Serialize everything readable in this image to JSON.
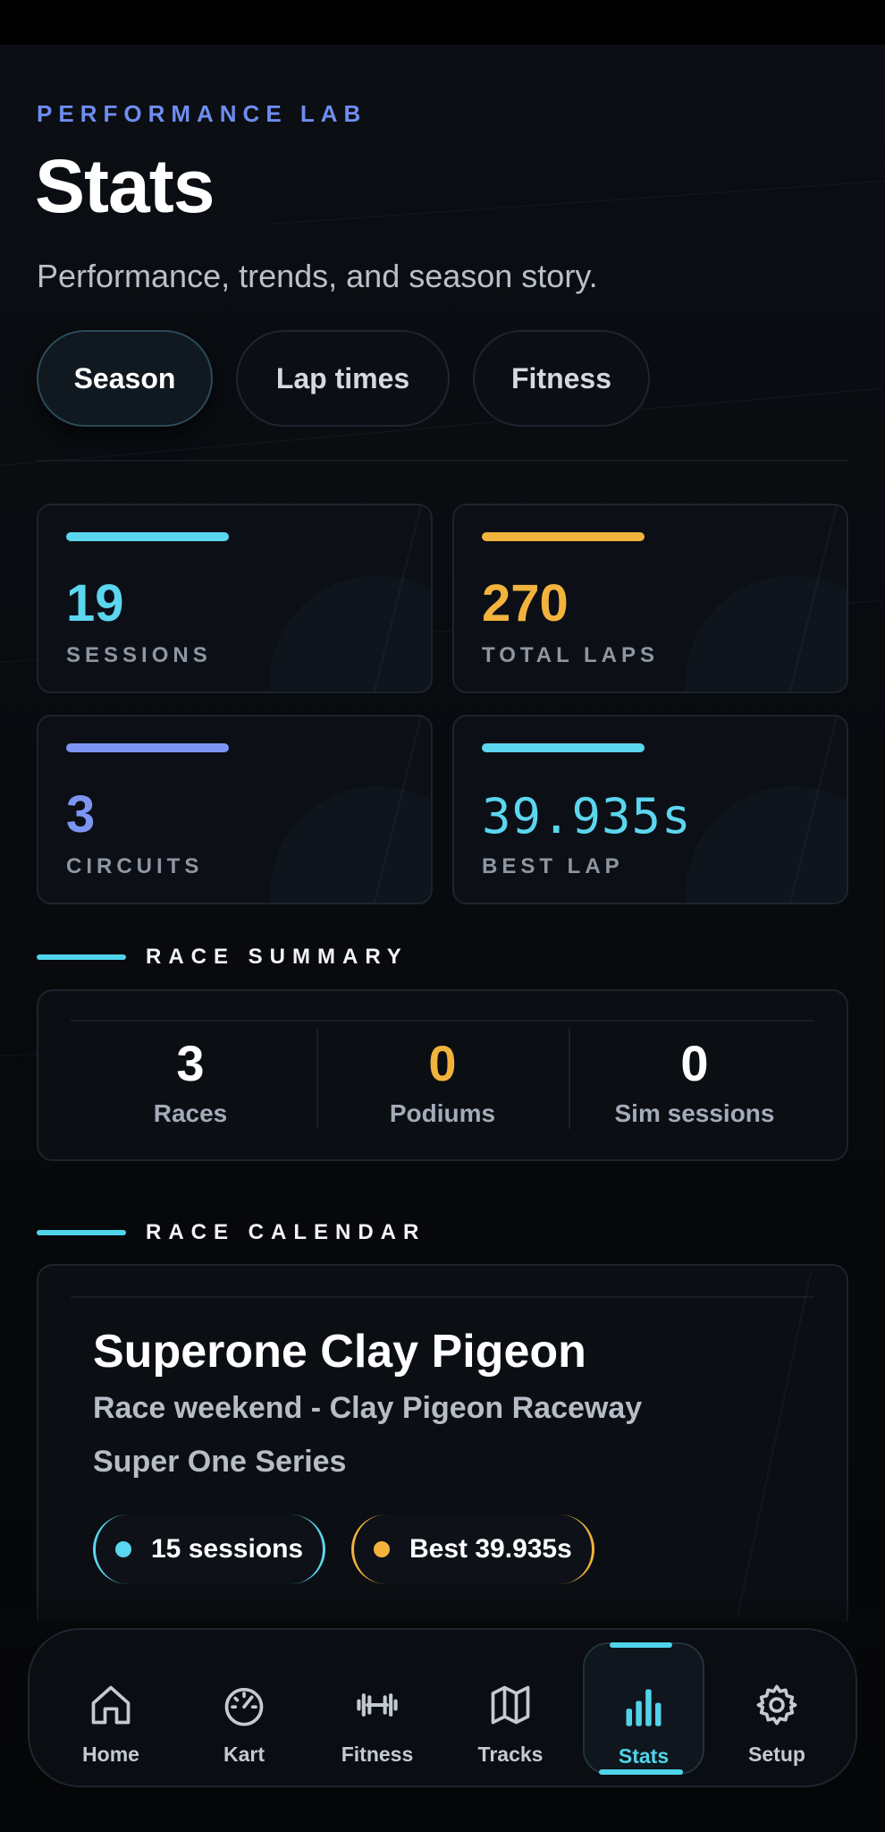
{
  "header": {
    "eyebrow": "PERFORMANCE LAB",
    "title": "Stats",
    "subtitle": "Performance, trends, and season story."
  },
  "tabs": [
    {
      "label": "Season",
      "active": true
    },
    {
      "label": "Lap times",
      "active": false
    },
    {
      "label": "Fitness",
      "active": false
    }
  ],
  "stats": [
    {
      "value": "19",
      "label": "SESSIONS",
      "color": "#5bd6ef"
    },
    {
      "value": "270",
      "label": "TOTAL LAPS",
      "color": "#f2b33d"
    },
    {
      "value": "3",
      "label": "CIRCUITS",
      "color": "#7d95f2"
    },
    {
      "value": "39.935s",
      "label": "BEST LAP",
      "color": "#5bd6ef"
    }
  ],
  "race_summary": {
    "heading": "RACE SUMMARY",
    "items": [
      {
        "value": "3",
        "label": "Races",
        "color": "#ffffff"
      },
      {
        "value": "0",
        "label": "Podiums",
        "color": "#f2b33d"
      },
      {
        "value": "0",
        "label": "Sim sessions",
        "color": "#ffffff"
      }
    ]
  },
  "race_calendar": {
    "heading": "RACE CALENDAR",
    "event": {
      "title": "Superone Clay Pigeon",
      "subtitle": "Race weekend - Clay Pigeon Raceway",
      "series": "Super One Series",
      "pills": [
        {
          "label": "15 sessions",
          "dot_color": "#5bd6ef"
        },
        {
          "label": "Best 39.935s",
          "dot_color": "#f2b33d"
        }
      ]
    }
  },
  "nav": {
    "items": [
      {
        "label": "Home",
        "icon": "home-icon"
      },
      {
        "label": "Kart",
        "icon": "speedometer-icon"
      },
      {
        "label": "Fitness",
        "icon": "dumbbell-icon"
      },
      {
        "label": "Tracks",
        "icon": "map-icon"
      },
      {
        "label": "Stats",
        "icon": "bar-chart-icon",
        "active": true
      },
      {
        "label": "Setup",
        "icon": "gear-icon"
      }
    ]
  },
  "colors": {
    "accent_cyan": "#50d4ea",
    "accent_amber": "#f2b33d",
    "accent_blue": "#6f8df0",
    "background": "#06080b"
  }
}
